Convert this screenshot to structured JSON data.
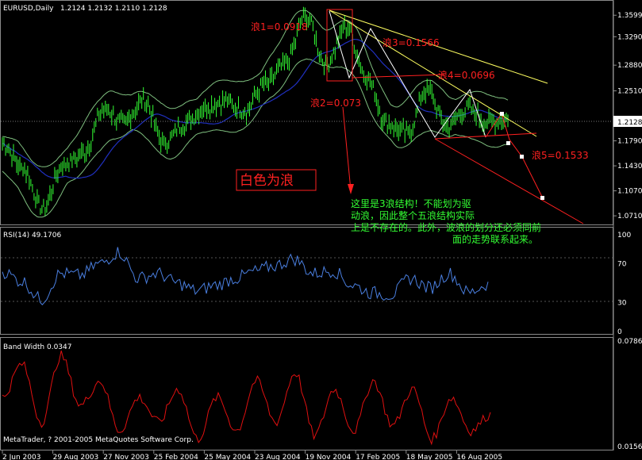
{
  "header": {
    "symbol": "EURUSD,Daily",
    "ohlc": "1.2124 1.2132 1.2110 1.2128"
  },
  "price_panel": {
    "ticks": [
      "1.3599",
      "1.3290",
      "1.2880",
      "1.2510",
      "1.1790",
      "1.1430",
      "1.1070",
      "1.0710"
    ],
    "current_price": "1.2128"
  },
  "rsi_panel": {
    "label": "RSI(14) 49.1706",
    "ticks": [
      "100",
      "70",
      "30",
      "0"
    ]
  },
  "bw_panel": {
    "label": "Band Width 0.0347",
    "ticks": [
      "0.0786",
      "0.0156"
    ]
  },
  "footer": {
    "copyright": "MetaTrader, ? 2001-2005 MetaQuotes Software Corp."
  },
  "x_axis": {
    "dates": [
      "2 Jun 2003",
      "29 Aug 2003",
      "27 Nov 2003",
      "25 Feb 2004",
      "25 May 2004",
      "23 Aug 2004",
      "19 Nov 2004",
      "17 Feb 2005",
      "18 May 2005",
      "16 Aug 2005"
    ]
  },
  "annotations": {
    "wave1": "浪1=0.0918",
    "wave2": "浪2=0.073",
    "wave3": "浪3=0.1566",
    "wave4": "浪4=0.0696",
    "wave5": "浪5=0.1533",
    "white_wave": "白色为浪",
    "comment_l1": "这里是3浪结构！不能划为驱",
    "comment_l2": "动浪，因此整个五浪结构实际",
    "comment_l3": "上是不存在的。此外，波浪的划分还必须同前",
    "comment_l4": "面的走势联系起来。"
  },
  "colors": {
    "price": "#33ff33",
    "band": "#7fbf7f",
    "ma": "#2030c0",
    "rsi": "#4a7fe0",
    "bandwidth": "#e01010",
    "annotation": "#ff2020",
    "comment": "#33ff33",
    "trend": "#ffff60"
  },
  "chart_data": [
    {
      "type": "line",
      "series": [
        {
          "name": "EURUSD,Daily",
          "values": [
            1.175,
            1.14,
            1.082,
            1.145,
            1.16,
            1.225,
            1.205,
            1.237,
            1.175,
            1.204,
            1.227,
            1.236,
            1.222,
            1.262,
            1.289,
            1.359,
            1.289,
            1.344,
            1.272,
            1.205,
            1.19,
            1.252,
            1.2,
            1.225,
            1.205,
            1.21
          ]
        }
      ],
      "x": [
        "2 Jun 2003",
        "29 Aug 2003",
        "27 Nov 2003",
        "25 Feb 2004",
        "25 May 2004",
        "23 Aug 2004",
        "19 Nov 2004",
        "17 Feb 2005",
        "18 May 2005",
        "16 Aug 2005"
      ],
      "ylim": [
        1.062,
        1.375
      ],
      "grid": false
    },
    {
      "type": "line",
      "series": [
        {
          "name": "RSI(14)",
          "values": [
            62,
            52,
            33,
            60,
            58,
            70,
            82,
            55,
            60,
            50,
            42,
            48,
            55,
            62,
            68,
            75,
            60,
            63,
            48,
            40,
            38,
            55,
            45,
            60,
            40,
            49
          ]
        }
      ],
      "ylim": [
        0,
        100
      ]
    },
    {
      "type": "line",
      "series": [
        {
          "name": "Band Width",
          "values": [
            0.045,
            0.065,
            0.03,
            0.07,
            0.04,
            0.055,
            0.025,
            0.045,
            0.03,
            0.05,
            0.02,
            0.045,
            0.025,
            0.055,
            0.03,
            0.06,
            0.022,
            0.05,
            0.025,
            0.055,
            0.028,
            0.05,
            0.02,
            0.045,
            0.025,
            0.0347
          ]
        }
      ],
      "ylim": [
        0.0156,
        0.0786
      ]
    }
  ]
}
